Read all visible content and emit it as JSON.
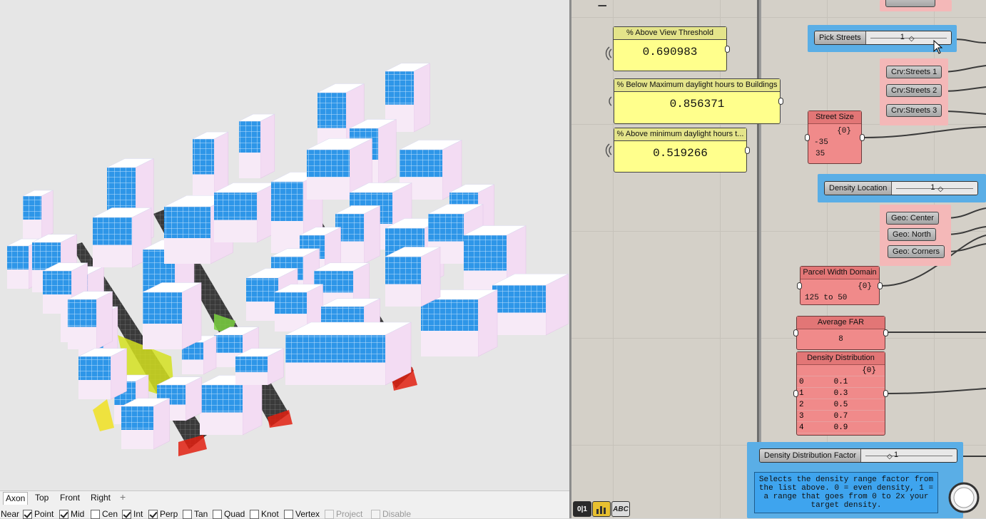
{
  "viewport": {
    "tabs": [
      "Axon",
      "Top",
      "Front",
      "Right"
    ],
    "active_tab": "Axon",
    "add_tab_symbol": "+"
  },
  "osnaps": [
    {
      "label": "Near",
      "checked": false,
      "has_box": false
    },
    {
      "label": "Point",
      "checked": true
    },
    {
      "label": "Mid",
      "checked": true
    },
    {
      "label": "Cen",
      "checked": false
    },
    {
      "label": "Int",
      "checked": true
    },
    {
      "label": "Perp",
      "checked": true
    },
    {
      "label": "Tan",
      "checked": false
    },
    {
      "label": "Quad",
      "checked": false
    },
    {
      "label": "Knot",
      "checked": false
    },
    {
      "label": "Vertex",
      "checked": false
    },
    {
      "label": "Project",
      "checked": false,
      "disabled": true
    },
    {
      "label": "Disable",
      "checked": false,
      "disabled": true
    }
  ],
  "canvas": {
    "panels": {
      "view_threshold": {
        "title": "% Above View Threshold",
        "value": "0.690983"
      },
      "below_max": {
        "title": "% Below Maximum daylight hours to Buildings",
        "value": "0.856371"
      },
      "above_min": {
        "title": "% Above minimum daylight hours t...",
        "value": "0.519266"
      }
    },
    "pick_streets": {
      "label": "Pick Streets",
      "value": "1"
    },
    "street_curves": [
      "Crv:Streets 1",
      "Crv:Streets 2",
      "Crv:Streets 3"
    ],
    "street_size": {
      "title": "Street Size",
      "path": "{0}",
      "values": [
        "-35",
        "35"
      ]
    },
    "density_location": {
      "label": "Density Location",
      "value": "1"
    },
    "geo_params": [
      "Geo: Center",
      "Geo: North",
      "Geo: Corners"
    ],
    "parcel_width": {
      "title": "Parcel Width Domain",
      "path": "{0}",
      "value": "125 to 50"
    },
    "average_far": {
      "title": "Average FAR",
      "value": "8"
    },
    "density_distribution": {
      "title": "Density Distribution",
      "path": "{0}",
      "rows": [
        {
          "index": "0",
          "value": "0.1"
        },
        {
          "index": "1",
          "value": "0.3"
        },
        {
          "index": "2",
          "value": "0.5"
        },
        {
          "index": "3",
          "value": "0.7"
        },
        {
          "index": "4",
          "value": "0.9"
        }
      ]
    },
    "density_factor": {
      "label": "Density Distribution Factor",
      "value": "1"
    },
    "note": "Selects the density range factor from the list above. 0 = even density, 1 = a range that goes from 0 to 2x your target density.",
    "toolbar_icons": [
      "0|1",
      "chart",
      "ABC"
    ]
  },
  "colors": {
    "panel_yellow": "#ffff8c",
    "panel_red": "#f08a8a",
    "group_blue": "#5aaee6",
    "group_pink": "#f4b8b8",
    "facade_blue": "#2e96e8"
  }
}
